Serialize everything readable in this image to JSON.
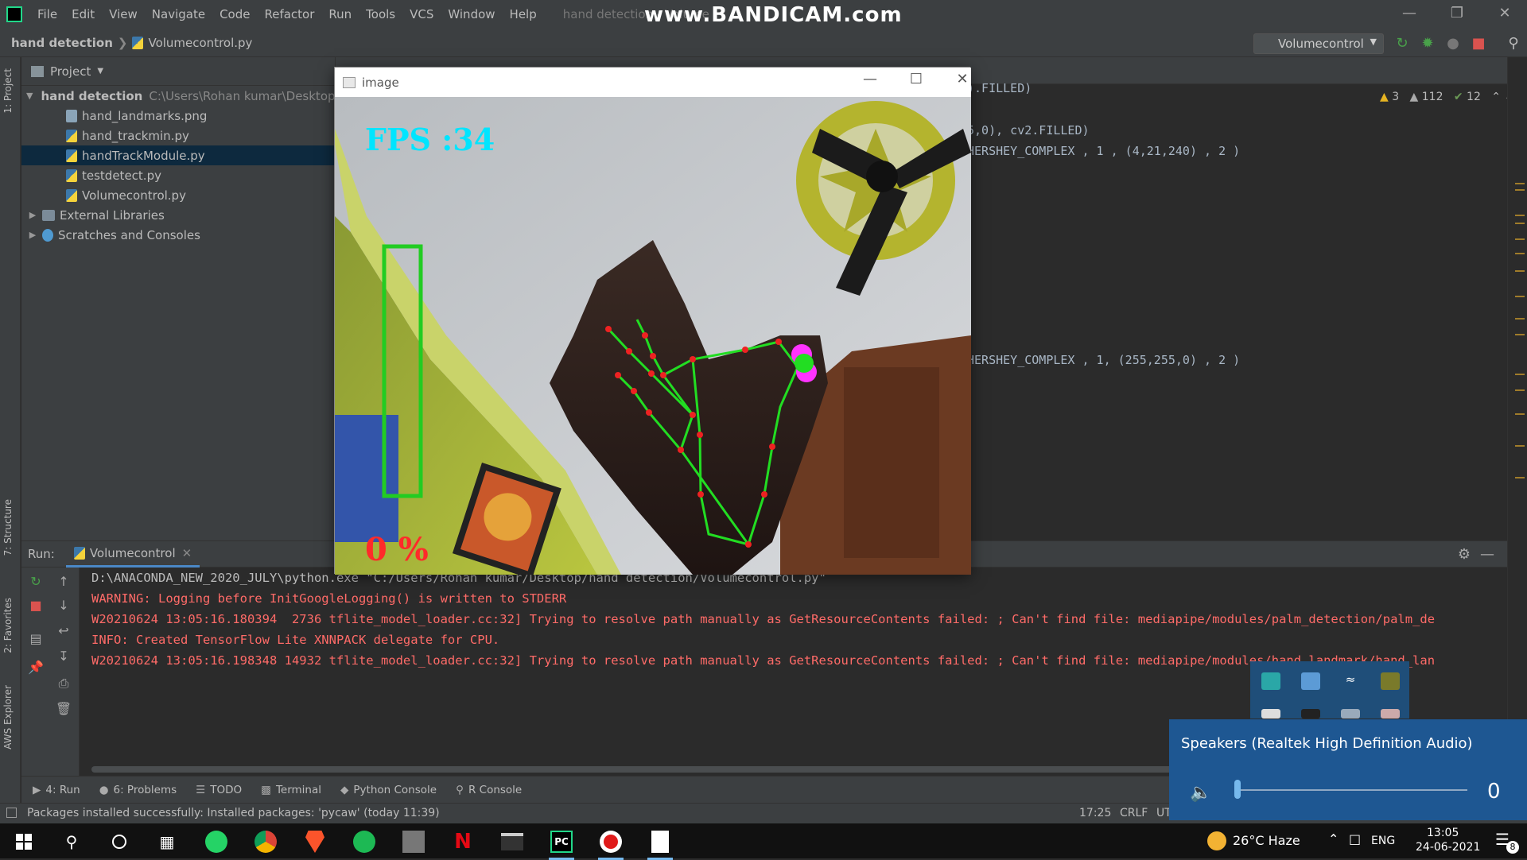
{
  "menubar": {
    "items": [
      "File",
      "Edit",
      "View",
      "Navigate",
      "Code",
      "Refactor",
      "Run",
      "Tools",
      "VCS",
      "Window",
      "Help"
    ],
    "window_title": "hand detection - Volume",
    "watermark": "www.BANDICAM.com"
  },
  "navbar": {
    "crumb_project": "hand detection",
    "crumb_file": "Volumecontrol.py",
    "run_config": "Volumecontrol"
  },
  "left_stripe": {
    "project_tab": "1: Project",
    "structure_tab": "7: Structure",
    "favorites_tab": "2: Favorites",
    "aws_tab": "AWS Explorer"
  },
  "project": {
    "header": "Project",
    "root_name": "hand detection",
    "root_path": "C:\\Users\\Rohan kumar\\Desktop\\h",
    "files": [
      "hand_landmarks.png",
      "hand_trackmin.py",
      "handTrackModule.py",
      "testdetect.py",
      "Volumecontrol.py"
    ],
    "external_libraries": "External Libraries",
    "scratches": "Scratches and Consoles"
  },
  "editor": {
    "lines": [
      ").FILLED)",
      "5,0), cv2.FILLED)",
      "HERSHEY_COMPLEX , 1 , (4,21,240) , 2 )",
      "HERSHEY_COMPLEX , 1, (255,255,0) , 2 )"
    ],
    "inspections": {
      "warnings_a": "3",
      "warnings_b": "112",
      "ok": "12"
    }
  },
  "image_window": {
    "title": "image",
    "fps_text": "FPS :34",
    "volume_percent_text": "0 %",
    "volume_level": 0
  },
  "run_panel": {
    "label": "Run:",
    "tab": "Volumecontrol",
    "lines": [
      {
        "text": "D:\\ANACONDA_NEW_2020_JULY\\python.exe \"C:/Users/Rohan kumar/Desktop/hand detection/Volumecontrol.py\"",
        "color": "white"
      },
      {
        "text": "WARNING: Logging before InitGoogleLogging() is written to STDERR",
        "color": "red"
      },
      {
        "text": "W20210624 13:05:16.180394  2736 tflite_model_loader.cc:32] Trying to resolve path manually as GetResourceContents failed: ; Can't find file: mediapipe/modules/palm_detection/palm_de",
        "color": "red"
      },
      {
        "text": "INFO: Created TensorFlow Lite XNNPACK delegate for CPU.",
        "color": "red"
      },
      {
        "text": "W20210624 13:05:16.198348 14932 tflite_model_loader.cc:32] Trying to resolve path manually as GetResourceContents failed: ; Can't find file: mediapipe/modules/hand_landmark/hand_lan",
        "color": "red"
      }
    ]
  },
  "bottom_tabs": [
    "4: Run",
    "6: Problems",
    "TODO",
    "Terminal",
    "Python Console",
    "R Console"
  ],
  "status": {
    "message": "Packages installed successfully: Installed packages: 'pycaw' (today 11:39)",
    "position": "17:25",
    "line_sep": "CRLF",
    "encoding": "UT"
  },
  "volume_popup": {
    "device": "Speakers (Realtek High Definition Audio)",
    "value": "0",
    "level": 0
  },
  "taskbar": {
    "weather": "26°C  Haze",
    "language": "ENG",
    "time": "13:05",
    "date": "24-06-2021",
    "notifications": "8",
    "apps": [
      "start",
      "search",
      "cortana",
      "task-view",
      "whatsapp",
      "chrome",
      "brave",
      "spotify",
      "nvidia",
      "netflix",
      "terminal",
      "pycharm",
      "bandicam",
      "file"
    ]
  },
  "colors": {
    "accent": "#4a88c7",
    "error": "#ff6b68",
    "hand_lines": "#22dd22",
    "hand_points": "#dd2222",
    "fps_text": "#00e5ff",
    "percent_text": "#ff2a2a"
  }
}
